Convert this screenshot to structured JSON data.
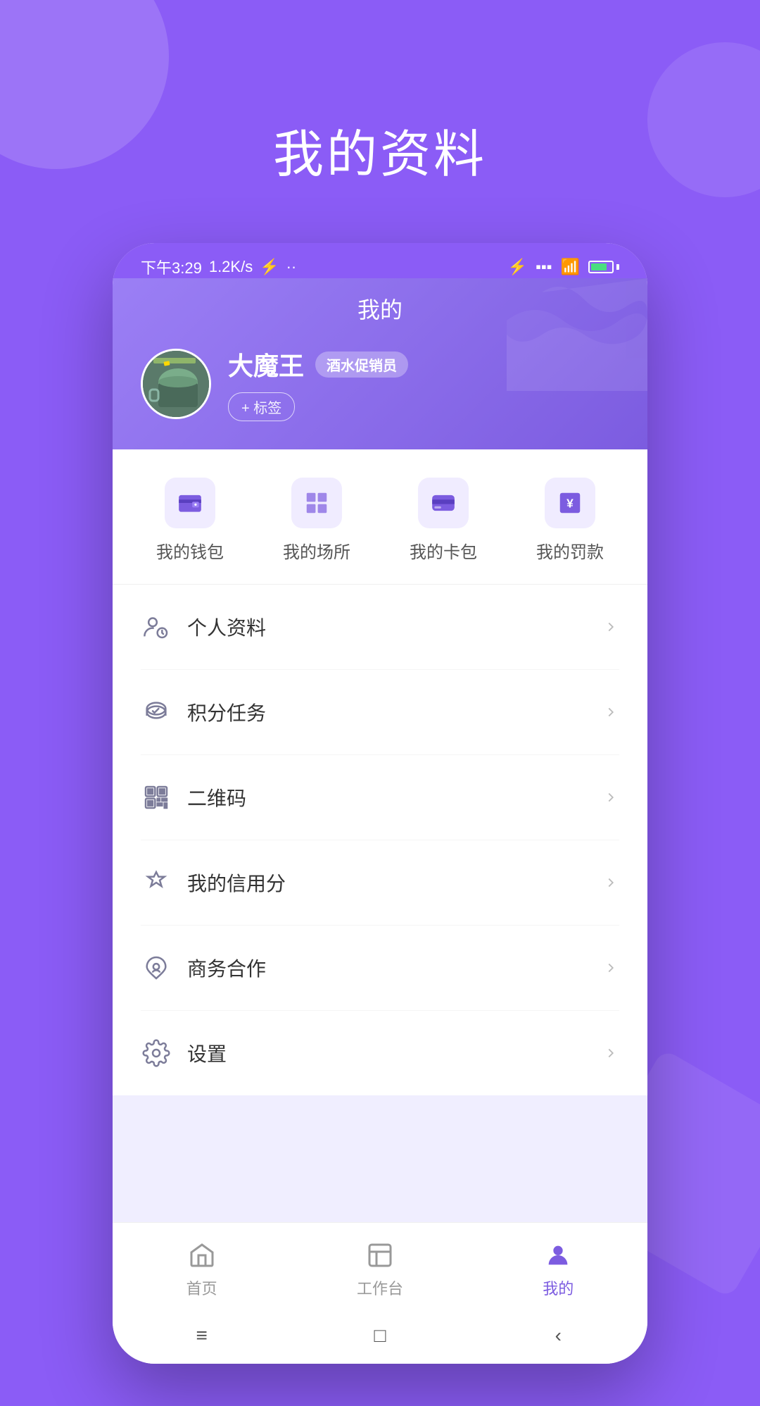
{
  "background": {
    "color": "#8b5cf6"
  },
  "page_title": "我的资料",
  "status_bar": {
    "time": "下午3:29",
    "network_speed": "1.2K/s",
    "battery_level": "87"
  },
  "app_header": {
    "title": "我的",
    "user_name": "大魔王",
    "role_badge": "酒水促销员",
    "tag_button": "+ 标签"
  },
  "quick_access": [
    {
      "id": "wallet",
      "label": "我的钱包"
    },
    {
      "id": "venue",
      "label": "我的场所"
    },
    {
      "id": "card",
      "label": "我的卡包"
    },
    {
      "id": "fine",
      "label": "我的罚款"
    }
  ],
  "menu_items": [
    {
      "id": "profile",
      "label": "个人资料"
    },
    {
      "id": "points",
      "label": "积分任务"
    },
    {
      "id": "qrcode",
      "label": "二维码"
    },
    {
      "id": "credit",
      "label": "我的信用分"
    },
    {
      "id": "business",
      "label": "商务合作"
    },
    {
      "id": "settings",
      "label": "设置"
    }
  ],
  "bottom_nav": [
    {
      "id": "home",
      "label": "首页",
      "active": false
    },
    {
      "id": "workbench",
      "label": "工作台",
      "active": false
    },
    {
      "id": "mine",
      "label": "我的",
      "active": true
    }
  ],
  "sys_nav": {
    "menu": "≡",
    "home": "□",
    "back": "‹"
  }
}
